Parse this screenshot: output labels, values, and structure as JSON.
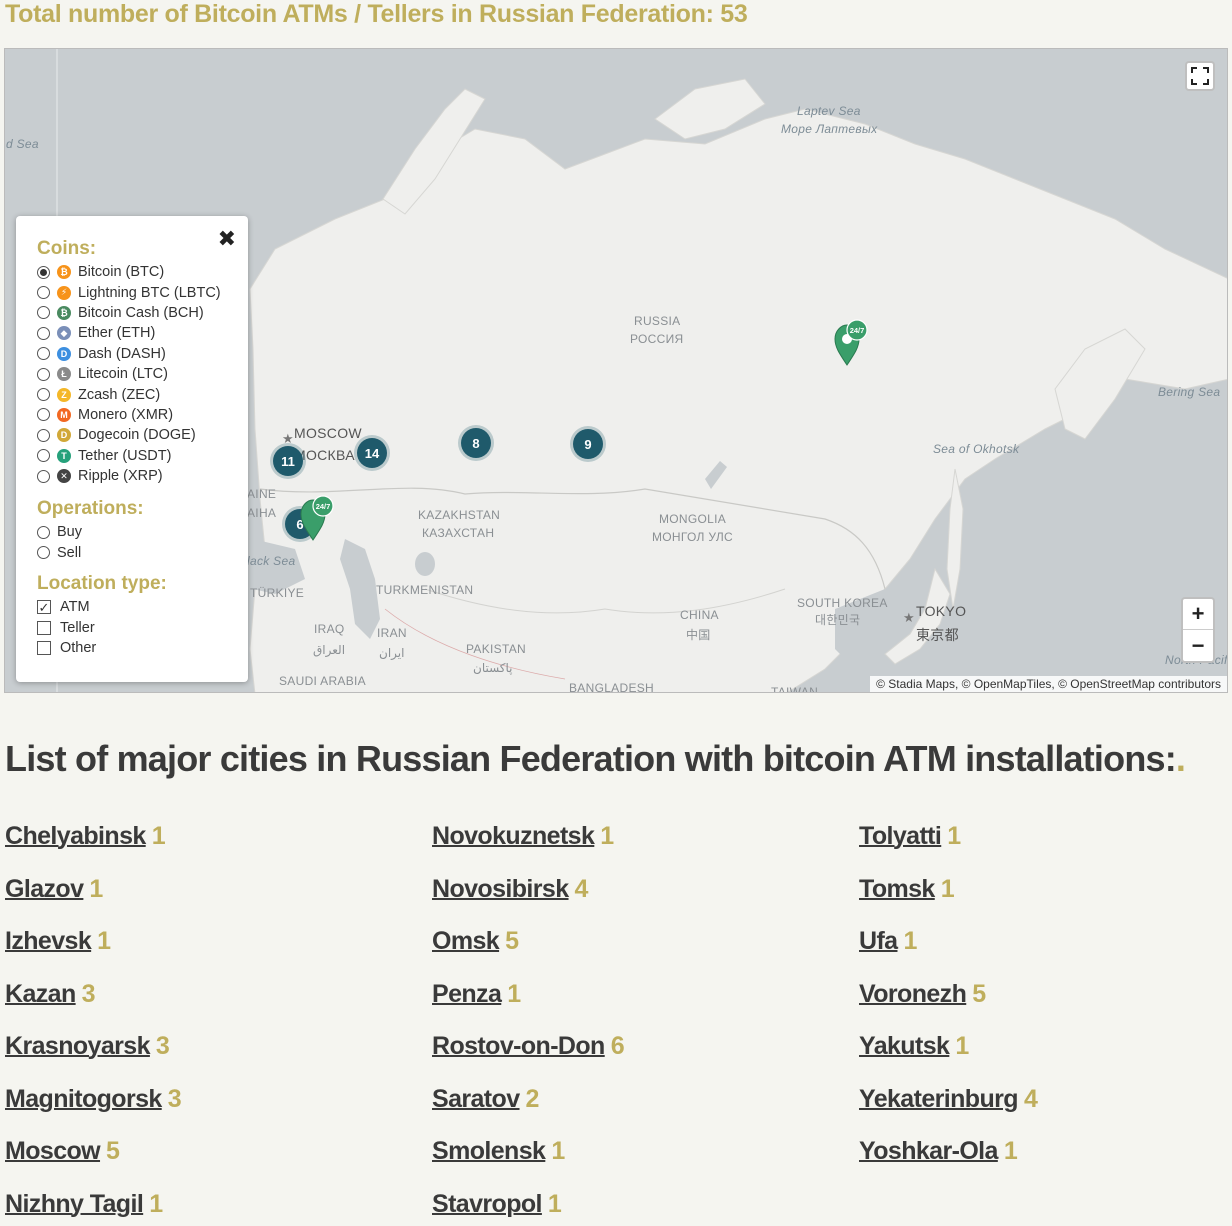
{
  "header": {
    "total_title": "Total number of Bitcoin ATMs / Tellers in Russian Federation: 53"
  },
  "map": {
    "attribution": "© Stadia Maps, © OpenMapTiles, © OpenStreetMap contributors",
    "zoom_in": "+",
    "zoom_out": "−",
    "labels": {
      "laptev_en": "Laptev Sea",
      "laptev_ru": "Море Лаптевых",
      "russia_en": "RUSSIA",
      "russia_ru": "РОССИЯ",
      "bering": "Bering Sea",
      "okhotsk": "Sea of Okhotsk",
      "moscow_en": "MOSCOW",
      "moscow_ru": "МОСКВА",
      "kazakhstan_en": "KAZAKHSTAN",
      "kazakhstan_ru": "КАЗАХСТАН",
      "mongolia_en": "MONGOLIA",
      "mongolia_ru": "МОНГОЛ УЛС",
      "turkmenistan": "TURKMENISTAN",
      "china_en": "CHINA",
      "china_zh": "中国",
      "south_korea_en": "SOUTH KOREA",
      "south_korea_ko": "대한민국",
      "tokyo_en": "TOKYO",
      "tokyo_ja": "東京都",
      "iraq_en": "IRAQ",
      "iraq_ar": "العراق",
      "iran_en": "IRAN",
      "iran_fa": "ایران",
      "pakistan_en": "PAKISTAN",
      "pakistan_ur": "پاکستان",
      "saudi": "SAUDI ARABIA",
      "bangladesh": "BANGLADESH",
      "turkiye": "TÜRKIYE",
      "black_sea": "lack Sea",
      "d_sea": "d Sea",
      "north_pacific": "North Pacifi",
      "taiwan": "TAIWAN",
      "ukraine": "AINE",
      "ukraine_ru": "AIHA"
    },
    "clusters": [
      {
        "label": "11"
      },
      {
        "label": "14"
      },
      {
        "label": "8"
      },
      {
        "label": "9"
      },
      {
        "label": "6"
      }
    ],
    "pin_badge": "24/7"
  },
  "filters": {
    "coins_heading": "Coins:",
    "coins": [
      {
        "label": "Bitcoin (BTC)",
        "checked": true,
        "color": "#f7931a",
        "glyph": "₿"
      },
      {
        "label": "Lightning BTC (LBTC)",
        "checked": false,
        "color": "#f7931a",
        "glyph": "⚡"
      },
      {
        "label": "Bitcoin Cash (BCH)",
        "checked": false,
        "color": "#4a8a60",
        "glyph": "₿"
      },
      {
        "label": "Ether (ETH)",
        "checked": false,
        "color": "#7a8fb8",
        "glyph": "◆"
      },
      {
        "label": "Dash (DASH)",
        "checked": false,
        "color": "#3d8fe0",
        "glyph": "D"
      },
      {
        "label": "Litecoin (LTC)",
        "checked": false,
        "color": "#8a8a8a",
        "glyph": "Ł"
      },
      {
        "label": "Zcash (ZEC)",
        "checked": false,
        "color": "#f4b728",
        "glyph": "Z"
      },
      {
        "label": "Monero (XMR)",
        "checked": false,
        "color": "#f26822",
        "glyph": "M"
      },
      {
        "label": "Dogecoin (DOGE)",
        "checked": false,
        "color": "#d1a838",
        "glyph": "D"
      },
      {
        "label": "Tether (USDT)",
        "checked": false,
        "color": "#26a17b",
        "glyph": "T"
      },
      {
        "label": "Ripple (XRP)",
        "checked": false,
        "color": "#444444",
        "glyph": "✕"
      }
    ],
    "operations_heading": "Operations:",
    "operations": [
      {
        "label": "Buy"
      },
      {
        "label": "Sell"
      }
    ],
    "location_heading": "Location type:",
    "locations": [
      {
        "label": "ATM",
        "checked": true
      },
      {
        "label": "Teller",
        "checked": false
      },
      {
        "label": "Other",
        "checked": false
      }
    ]
  },
  "cities_section": {
    "title": "List of major cities in Russian Federation with bitcoin ATM installations:",
    "title_dot": ".",
    "columns": [
      [
        {
          "name": "Chelyabinsk",
          "count": "1"
        },
        {
          "name": "Glazov",
          "count": "1"
        },
        {
          "name": "Izhevsk",
          "count": "1"
        },
        {
          "name": "Kazan",
          "count": "3"
        },
        {
          "name": "Krasnoyarsk",
          "count": "3"
        },
        {
          "name": "Magnitogorsk",
          "count": "3"
        },
        {
          "name": "Moscow",
          "count": "5"
        },
        {
          "name": "Nizhny Tagil",
          "count": "1"
        }
      ],
      [
        {
          "name": "Novokuznetsk",
          "count": "1"
        },
        {
          "name": "Novosibirsk",
          "count": "4"
        },
        {
          "name": "Omsk",
          "count": "5"
        },
        {
          "name": "Penza",
          "count": "1"
        },
        {
          "name": "Rostov-on-Don",
          "count": "6"
        },
        {
          "name": "Saratov",
          "count": "2"
        },
        {
          "name": "Smolensk",
          "count": "1"
        },
        {
          "name": "Stavropol",
          "count": "1"
        }
      ],
      [
        {
          "name": "Tolyatti",
          "count": "1"
        },
        {
          "name": "Tomsk",
          "count": "1"
        },
        {
          "name": "Ufa",
          "count": "1"
        },
        {
          "name": "Voronezh",
          "count": "5"
        },
        {
          "name": "Yakutsk",
          "count": "1"
        },
        {
          "name": "Yekaterinburg",
          "count": "4"
        },
        {
          "name": "Yoshkar-Ola",
          "count": "1"
        }
      ]
    ]
  }
}
